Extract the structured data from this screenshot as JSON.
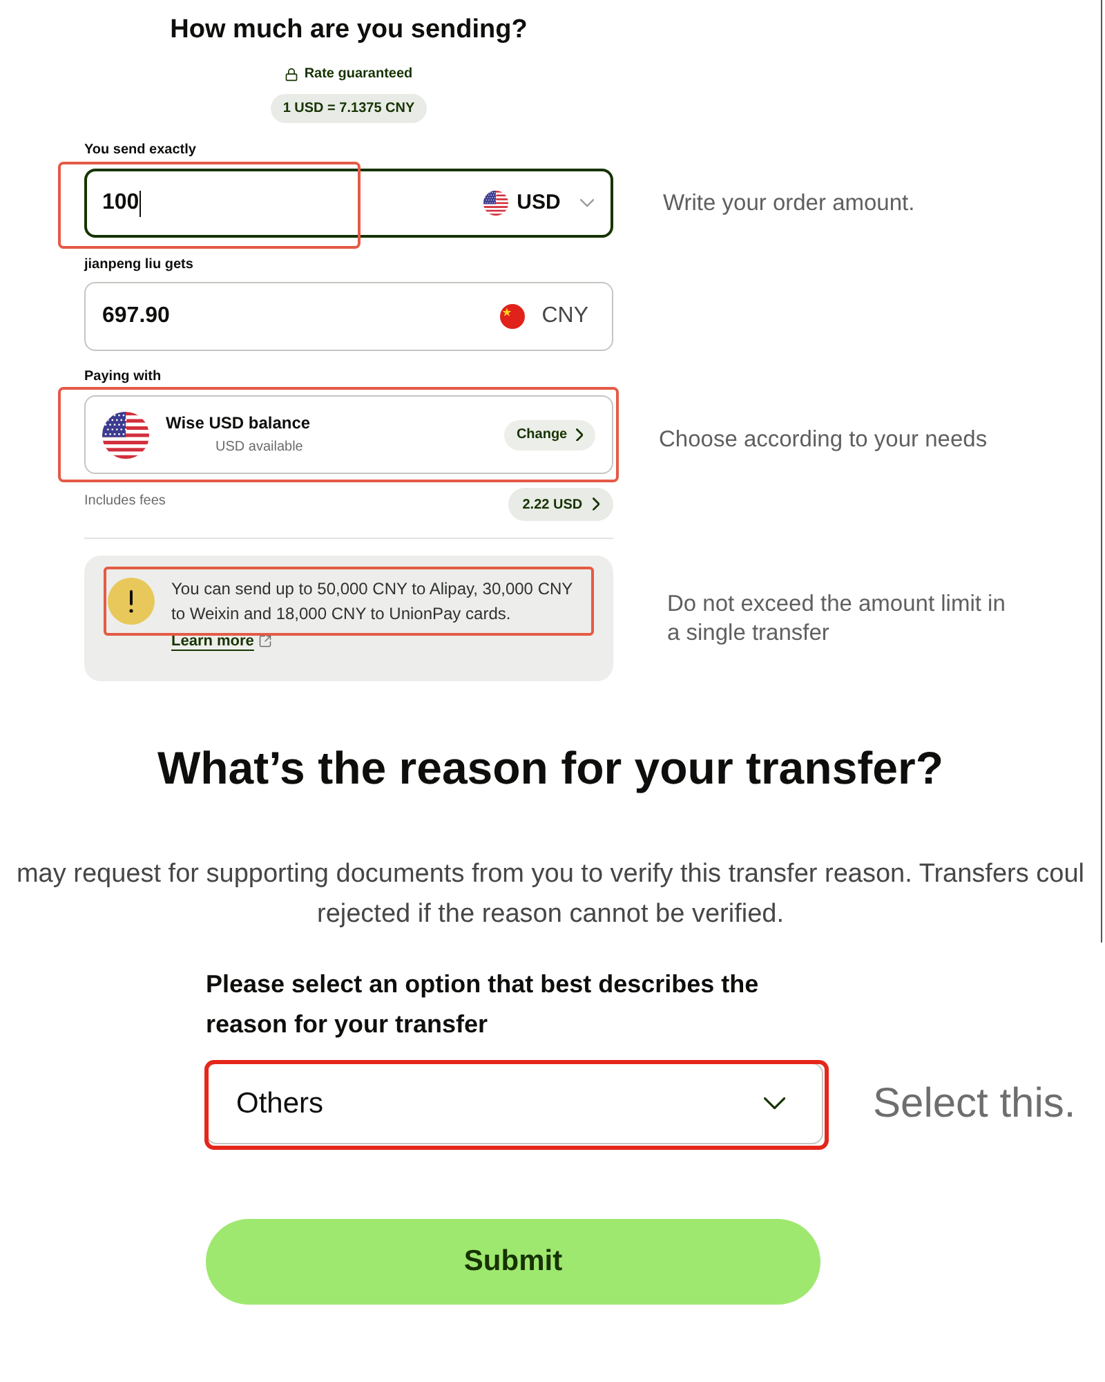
{
  "amount": {
    "title": "How much are you sending?",
    "rate_badge": "Rate guaranteed",
    "rate": "1 USD = 7.1375 CNY",
    "send": {
      "label": "You send exactly",
      "value": "100",
      "currency": "USD",
      "kind": "us",
      "dropdown": true,
      "focused": true,
      "highlighted": true,
      "note": "Write your order amount."
    },
    "receive": {
      "label": "jianpeng liu gets",
      "value": "697.90",
      "currency": "CNY",
      "kind": "cn",
      "dropdown": false,
      "focused": false
    },
    "paying_with": {
      "label": "Paying with",
      "method": "Wise USD balance",
      "kind": "us",
      "balance": "USD available",
      "action": "Change",
      "highlighted": true,
      "note": "Choose according to your needs"
    },
    "fees": {
      "label": "Includes fees",
      "amount": "2.22 USD"
    },
    "notice": {
      "text": "You can send up to 50,000 CNY to Alipay, 30,000 CNY to Weixin and 18,000 CNY to UnionPay cards.",
      "link": "Learn more",
      "highlighted": true,
      "note": "Do not exceed the amount limit in a single transfer"
    }
  },
  "reason": {
    "title": "What’s the reason for your transfer?",
    "description": "may request for supporting documents from you to verify this transfer reason. Transfers coul\nrejected if the reason cannot be verified.",
    "question": "Please select an option that best describes the reason for your transfer",
    "selected_option": "Others",
    "highlighted": true,
    "note": "Select this.",
    "submit": "Submit"
  }
}
